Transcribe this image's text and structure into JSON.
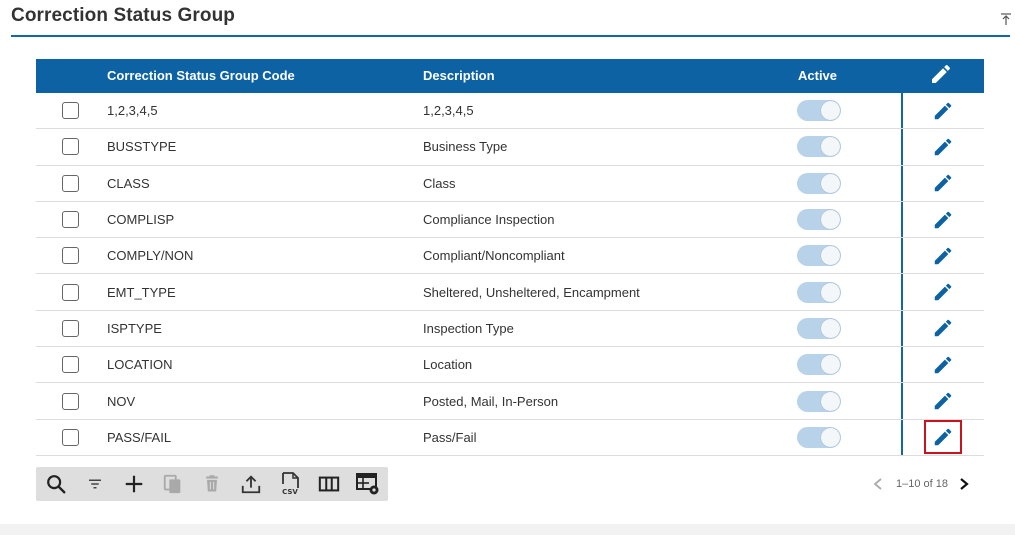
{
  "page": {
    "title": "Correction Status Group"
  },
  "grid": {
    "headers": {
      "code": "Correction Status Group Code",
      "description": "Description",
      "active": "Active"
    },
    "rows": [
      {
        "code": "1,2,3,4,5",
        "description": "1,2,3,4,5",
        "active": true
      },
      {
        "code": "BUSSTYPE",
        "description": "Business Type",
        "active": true
      },
      {
        "code": "CLASS",
        "description": "Class",
        "active": true
      },
      {
        "code": "COMPLISP",
        "description": "Compliance Inspection",
        "active": true
      },
      {
        "code": "COMPLY/NON",
        "description": "Compliant/Noncompliant",
        "active": true
      },
      {
        "code": "EMT_TYPE",
        "description": "Sheltered, Unsheltered, Encampment",
        "active": true
      },
      {
        "code": "ISPTYPE",
        "description": "Inspection Type",
        "active": true
      },
      {
        "code": "LOCATION",
        "description": "Location",
        "active": true
      },
      {
        "code": "NOV",
        "description": "Posted, Mail, In-Person",
        "active": true
      },
      {
        "code": "PASS/FAIL",
        "description": "Pass/Fail",
        "active": true
      }
    ]
  },
  "toolbar": {
    "icons": [
      "search-icon",
      "filter-icon",
      "add-icon",
      "copy-icon",
      "delete-icon",
      "export-icon",
      "csv-icon",
      "columns-icon",
      "grid-settings-icon"
    ]
  },
  "pager": {
    "range_text": "1–10 of 18"
  },
  "colors": {
    "header_bg": "#0d62a3",
    "accent": "#1565a8",
    "toggle_on": "#b8d2ea",
    "focus_outline": "#c8141e",
    "toolbar_bg": "#dedede"
  }
}
